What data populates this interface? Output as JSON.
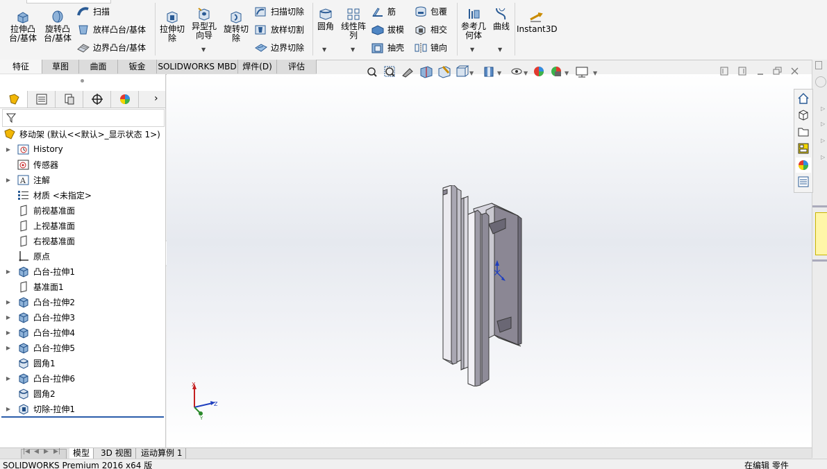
{
  "ribbon": {
    "extrude_boss": "拉伸凸\n台/基体",
    "revolve_boss": "旋转凸\n台/基体",
    "sweep": "扫描",
    "loft_boss": "放样凸台/基体",
    "boundary_boss": "边界凸台/基体",
    "extrude_cut": "拉伸切\n除",
    "hole_wizard": "异型孔\n向导",
    "revolve_cut": "旋转切\n除",
    "swept_cut": "扫描切除",
    "loft_cut": "放样切割",
    "boundary_cut": "边界切除",
    "fillet": "圆角",
    "linear_pattern": "线性阵\n列",
    "rib": "筋",
    "draft": "拔模",
    "shell": "抽壳",
    "wrap": "包覆",
    "intersect": "相交",
    "mirror": "镜向",
    "ref_geometry": "参考几\n何体",
    "curves": "曲线",
    "instant3d": "Instant3D"
  },
  "tabs": [
    "特征",
    "草图",
    "曲面",
    "钣金",
    "SOLIDWORKS MBD",
    "焊件(D)",
    "评估"
  ],
  "tree": {
    "root": "移动架 (默认<<默认>_显示状态 1>)",
    "items": [
      {
        "label": "History",
        "icon": "history-icon",
        "expandable": true
      },
      {
        "label": "传感器",
        "icon": "sensor-icon",
        "expandable": false
      },
      {
        "label": "注解",
        "icon": "annotation-icon",
        "expandable": true
      },
      {
        "label": "材质 <未指定>",
        "icon": "material-icon",
        "expandable": false
      },
      {
        "label": "前视基准面",
        "icon": "plane-icon",
        "expandable": false
      },
      {
        "label": "上视基准面",
        "icon": "plane-icon",
        "expandable": false
      },
      {
        "label": "右视基准面",
        "icon": "plane-icon",
        "expandable": false
      },
      {
        "label": "原点",
        "icon": "origin-icon",
        "expandable": false
      },
      {
        "label": "凸台-拉伸1",
        "icon": "extrude-feature-icon",
        "expandable": true
      },
      {
        "label": "基准面1",
        "icon": "plane-icon",
        "expandable": false
      },
      {
        "label": "凸台-拉伸2",
        "icon": "extrude-feature-icon",
        "expandable": true
      },
      {
        "label": "凸台-拉伸3",
        "icon": "extrude-feature-icon",
        "expandable": true
      },
      {
        "label": "凸台-拉伸4",
        "icon": "extrude-feature-icon",
        "expandable": true
      },
      {
        "label": "凸台-拉伸5",
        "icon": "extrude-feature-icon",
        "expandable": true
      },
      {
        "label": "圆角1",
        "icon": "fillet-feature-icon",
        "expandable": false
      },
      {
        "label": "凸台-拉伸6",
        "icon": "extrude-feature-icon",
        "expandable": true
      },
      {
        "label": "圆角2",
        "icon": "fillet-feature-icon",
        "expandable": false
      },
      {
        "label": "切除-拉伸1",
        "icon": "cut-feature-icon",
        "expandable": true
      }
    ]
  },
  "triad": {
    "x": "X",
    "y": "Y",
    "z": "Z"
  },
  "bottom_tabs": [
    "模型",
    "3D 视图",
    "运动算例 1"
  ],
  "status": {
    "left": "SOLIDWORKS Premium 2016 x64 版",
    "right": "在编辑 零件"
  }
}
